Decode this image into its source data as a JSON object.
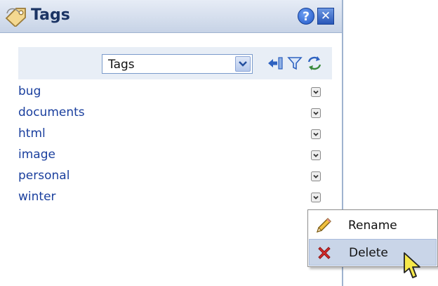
{
  "window": {
    "title": "Tags",
    "help_label": "?",
    "close_label": "✕"
  },
  "toolbar": {
    "select_value": "Tags",
    "icons": [
      "import-tags-icon",
      "filter-icon",
      "refresh-icon"
    ]
  },
  "tags": [
    {
      "label": "bug"
    },
    {
      "label": "documents"
    },
    {
      "label": "html"
    },
    {
      "label": "image"
    },
    {
      "label": "personal"
    },
    {
      "label": "winter"
    }
  ],
  "context_menu": {
    "items": [
      {
        "label": "Rename",
        "icon": "pencil-icon"
      },
      {
        "label": "Delete",
        "icon": "delete-x-icon"
      }
    ],
    "hovered_item": "Delete"
  },
  "colors": {
    "link": "#1a3f9e",
    "title_text": "#1b3464",
    "titlebar_top": "#e6ecf6",
    "titlebar_bottom": "#c7d3e6",
    "toolbar_bg": "#e8eef6",
    "menu_hover": "#c9d5e8"
  }
}
